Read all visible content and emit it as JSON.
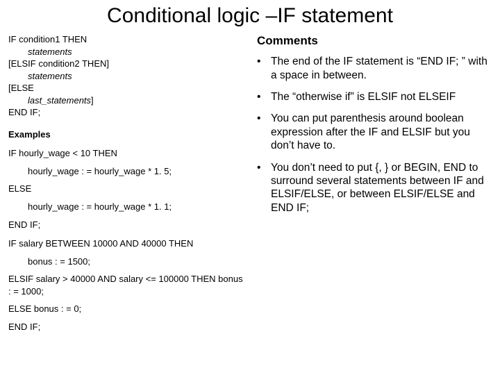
{
  "title": "Conditional logic –IF statement",
  "syntax": {
    "l1": "IF condition1 THEN",
    "l2": "statements",
    "l3": "[ELSIF condition2 THEN]",
    "l4": "statements",
    "l5": "[ELSE",
    "l6": "last_statements",
    "l6_suffix": "]",
    "l7": "END IF;"
  },
  "examples_heading": "Examples",
  "example1": {
    "l1": "IF hourly_wage < 10 THEN",
    "l2": "hourly_wage : = hourly_wage * 1. 5;",
    "l3": "ELSE",
    "l4": "hourly_wage : = hourly_wage * 1. 1;",
    "l5": "END IF;"
  },
  "example2": {
    "l1": "IF salary BETWEEN 10000 AND 40000 THEN",
    "l2": "bonus : = 1500;",
    "l3": "ELSIF salary > 40000 AND salary <= 100000 THEN bonus : = 1000;",
    "l4": "ELSE bonus : = 0;",
    "l5": "END IF;"
  },
  "comments_heading": "Comments",
  "bullets": {
    "b1": "The end of the IF statement is “END IF; ” with a space in between.",
    "b2": "The “otherwise if” is ELSIF not ELSEIF",
    "b3": "You can put parenthesis around boolean expression after the IF and ELSIF but you don’t have to.",
    "b4": "You don’t need to put {, } or BEGIN, END to surround several statements between IF and ELSIF/ELSE, or between ELSIF/ELSE and END IF;"
  }
}
